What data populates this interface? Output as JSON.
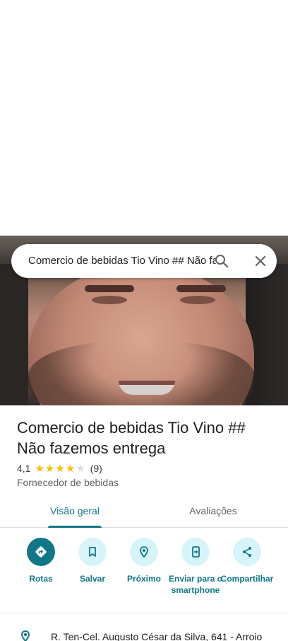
{
  "search": {
    "query": "Comercio de bebidas Tio Vino ## Não fazemos entrega",
    "search_icon": "search-icon",
    "close_icon": "close-icon"
  },
  "place": {
    "title": "Comercio de bebidas Tio Vino ## Não fazemos entrega",
    "rating": "4,1",
    "stars_filled": 4.1,
    "review_count": "(9)",
    "category": "Fornecedor de bebidas"
  },
  "tabs": [
    {
      "label": "Visão geral",
      "active": true
    },
    {
      "label": "Avaliações",
      "active": false
    }
  ],
  "actions": [
    {
      "label": "Rotas",
      "icon": "directions-icon"
    },
    {
      "label": "Salvar",
      "icon": "bookmark-icon"
    },
    {
      "label": "Próximo",
      "icon": "nearby-icon"
    },
    {
      "label": "Enviar para o smartphone",
      "icon": "send-to-phone-icon"
    },
    {
      "label": "Compartilhar",
      "icon": "share-icon"
    }
  ],
  "address": {
    "text": "R. Ten-Cel. Augusto César da Silva, 641 - Arroio",
    "icon": "location-pin-icon"
  },
  "colors": {
    "accent": "#0f7787",
    "action_bg": "#d6f4fa",
    "star": "#fbbc04"
  }
}
